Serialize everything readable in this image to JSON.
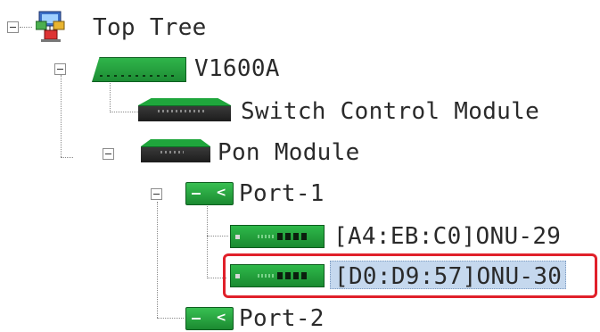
{
  "tree": {
    "root": {
      "label": "Top Tree"
    },
    "olt": {
      "label": "V1600A"
    },
    "switch_module": {
      "label": "Switch Control Module"
    },
    "pon_module": {
      "label": "Pon Module"
    },
    "port1": {
      "label": "Port-1"
    },
    "onu29": {
      "label": "[A4:EB:C0]ONU-29"
    },
    "onu30": {
      "label": "[D0:D9:57]ONU-30",
      "selected": true
    },
    "port2": {
      "label": "Port-2"
    }
  },
  "colors": {
    "device_green": "#1fa63c",
    "selection_bg": "#c5d8ee",
    "highlight_outline": "#e0202a"
  }
}
